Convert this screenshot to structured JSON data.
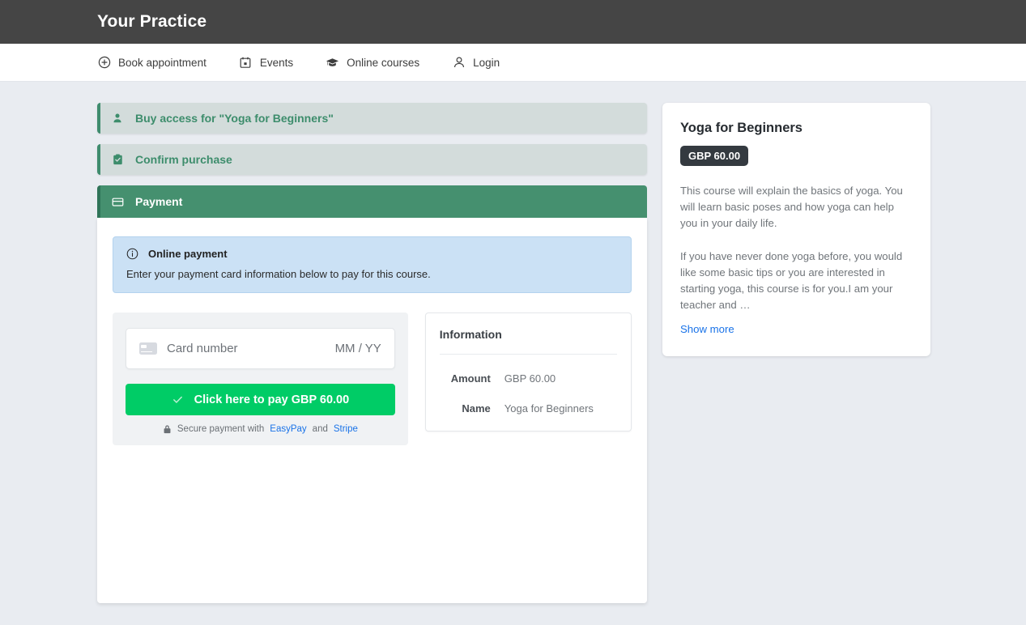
{
  "header": {
    "brand": "Your Practice"
  },
  "nav": {
    "items": [
      {
        "label": "Book appointment",
        "icon": "plus-circle-icon"
      },
      {
        "label": "Events",
        "icon": "calendar-icon"
      },
      {
        "label": "Online courses",
        "icon": "graduation-cap-icon"
      },
      {
        "label": "Login",
        "icon": "user-icon"
      }
    ]
  },
  "wizard": {
    "steps": [
      {
        "label": "Buy access for \"Yoga for Beginners\"",
        "icon": "user-icon",
        "state": "done"
      },
      {
        "label": "Confirm purchase",
        "icon": "clipboard-check-icon",
        "state": "done"
      },
      {
        "label": "Payment",
        "icon": "credit-card-icon",
        "state": "active"
      }
    ]
  },
  "alert": {
    "title": "Online payment",
    "icon": "info-circle-icon",
    "body": "Enter your payment card information below to pay for this course."
  },
  "card_form": {
    "card_icon": "credit-card-icon",
    "card_placeholder": "Card number",
    "card_value": "",
    "expiry_placeholder": "MM / YY",
    "expiry_value": "",
    "pay_button_label": "Click here to pay GBP 60.00",
    "pay_button_icon": "check-icon",
    "secure_icon": "lock-icon",
    "secure_prefix": "Secure payment with",
    "secure_link_1": "EasyPay",
    "secure_conjunction": "and",
    "secure_link_2": "Stripe"
  },
  "information": {
    "title": "Information",
    "rows": [
      {
        "label": "Amount",
        "value": "GBP 60.00"
      },
      {
        "label": "Name",
        "value": "Yoga for Beginners"
      }
    ]
  },
  "course_card": {
    "title": "Yoga for Beginners",
    "price_badge": "GBP 60.00",
    "paragraph_1": "This course will explain the basics of yoga. You will learn basic poses and how yoga can help you in your daily life.",
    "paragraph_2": "If you have never done yoga before, you would like some basic tips or you are interested in starting yoga, this course is for you.I am your teacher and …",
    "show_more": "Show more"
  },
  "colors": {
    "topbar": "#454545",
    "page_bg": "#e9ecf1",
    "accent_green": "#45906f",
    "step_done_bg": "#d3dcdb",
    "step_done_text": "#3d8d6c",
    "pay_green": "#00cc66",
    "alert_blue": "#cbe1f5",
    "link_blue": "#1a73e8",
    "badge_dark": "#343a40"
  }
}
